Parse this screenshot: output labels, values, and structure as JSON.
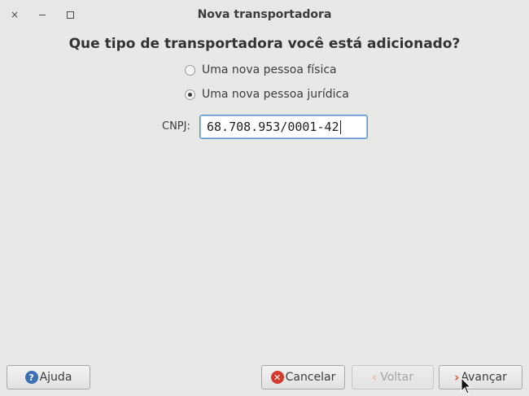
{
  "window": {
    "title": "Nova transportadora",
    "close_glyph": "×"
  },
  "question": "Que tipo de transportadora você está adicionado?",
  "options": [
    {
      "label": "Uma nova pessoa física",
      "selected": false
    },
    {
      "label": "Uma nova pessoa jurídica",
      "selected": true
    }
  ],
  "cnpj": {
    "label": "CNPJ:",
    "value": "68.708.953/0001-42"
  },
  "buttons": {
    "help": "Ajuda",
    "cancel": "Cancelar",
    "back": "Voltar",
    "next": "Avançar"
  },
  "icons": {
    "help": "help-icon",
    "cancel": "cancel-icon",
    "back": "chevron-left-icon",
    "next": "chevron-right-icon"
  },
  "colors": {
    "focus_border": "#5b8ec6",
    "next_chevron": "#e0552a",
    "cancel_icon": "#d43a2e",
    "help_icon": "#3d6fb5"
  }
}
